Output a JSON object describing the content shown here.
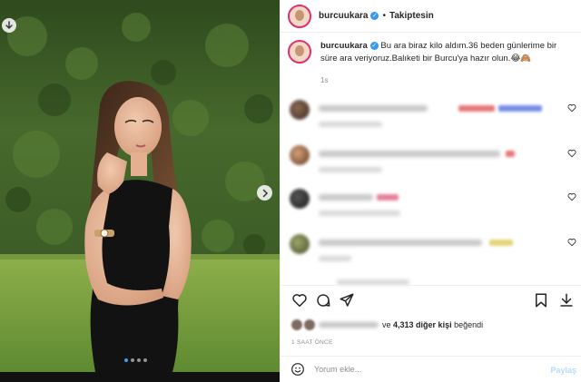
{
  "post": {
    "username": "burcuukara",
    "follow_status": "Takiptesin",
    "separator": "•",
    "caption_text": "Bu ara biraz kilo aldım.36 beden günlerime bir süre ara veriyoruz.Balıketi bir Burcu'ya hazır olun.😂🙈",
    "caption_time": "1s",
    "likes_prefix": "ve",
    "likes_count": "4,313 diğer kişi",
    "likes_suffix": "beğendi",
    "post_time": "1 SAAT ÖNCE"
  },
  "comment_input": {
    "placeholder": "Yorum ekle...",
    "submit_label": "Paylaş"
  },
  "carousel": {
    "slide_count": 4,
    "active_index": 0
  },
  "icons": {
    "save": "save-down-icon",
    "next": "chevron-right-icon",
    "verified": "verified-badge-icon",
    "heart": "heart-icon",
    "comment": "comment-icon",
    "share": "share-icon",
    "bookmark": "bookmark-icon",
    "emoji": "emoji-icon"
  },
  "colors": {
    "verified": "#3897f0",
    "submit_disabled": "#b3dbff",
    "muted": "#8e8e8e"
  }
}
